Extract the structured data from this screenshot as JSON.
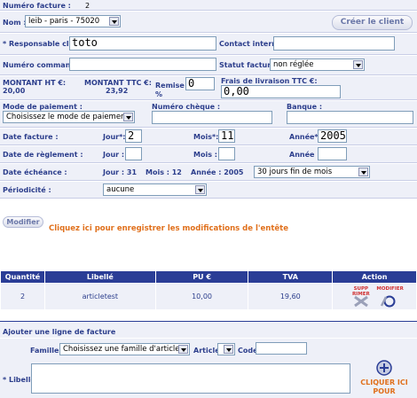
{
  "header": {
    "invoice_number_label": "Numéro facture :",
    "invoice_number_value": "2"
  },
  "client": {
    "name_label": "Nom :",
    "name_value": "leib - paris - 75020",
    "create_button": "Créer le client"
  },
  "contacts": {
    "responsable_label": "* Responsable client :",
    "responsable_value": "toto",
    "contact_interne_label": "Contact interne :",
    "contact_interne_value": ""
  },
  "order": {
    "numero_commande_label": "Numéro commande :",
    "numero_commande_value": "",
    "statut_label": "Statut facture :",
    "statut_value": "non réglée"
  },
  "amounts": {
    "ht_label": "MONTANT HT €:",
    "ht_value": "20,00",
    "ttc_label": "MONTANT TTC €:",
    "ttc_value": "23,92",
    "remise_label": "Remise :",
    "remise_unit": "%",
    "remise_value": "0",
    "frais_label": "Frais de livraison TTC €:",
    "frais_value": "0,00"
  },
  "payment": {
    "mode_label": "Mode de paiement :",
    "mode_value": "Choisissez le mode de paiement",
    "cheque_label": "Numéro chèque :",
    "cheque_value": "",
    "banque_label": "Banque :",
    "banque_value": ""
  },
  "dates": {
    "facture_label": "Date facture :",
    "reglement_label": "Date de règlement :",
    "echeance_label": "Date échéance :",
    "jour_label": "Jour*:",
    "mois_label": "Mois*:",
    "annee_label": "Année*:",
    "jour_label_plain": "Jour :",
    "mois_label_plain": "Mois :",
    "annee_label_plain": "Année :",
    "facture_jour": "2",
    "facture_mois": "11",
    "facture_annee": "2005",
    "echeance_jour": "Jour : 31",
    "echeance_mois": "Mois : 12",
    "echeance_annee": "Année : 2005",
    "echeance_terms": "30 jours fin de mois"
  },
  "periodicite": {
    "label": "Périodicité :",
    "value": "aucune"
  },
  "modify": {
    "button": "Modifier",
    "hint": "Cliquez ici pour enregistrer les modifications de l'entête"
  },
  "lines_table": {
    "headers": [
      "Quantité",
      "Libellé",
      "PU €",
      "TVA",
      "Action"
    ],
    "rows": [
      {
        "quantite": "2",
        "libelle": "articletest",
        "pu": "10,00",
        "tva": "19,60",
        "supp": "SUPP RIMER",
        "modifier": "MODIFIER"
      }
    ]
  },
  "add_line": {
    "title": "Ajouter une ligne de facture",
    "famille_label": "Famille :",
    "famille_value": "Choisissez une famille d'articles",
    "article_label": "Article",
    "code_label": "Code",
    "code_value": "",
    "libelle_label": "* Libellé:",
    "libelle_value": "",
    "add_button_line1": "CLIQUER ICI",
    "add_button_line2": "POUR"
  },
  "colors": {
    "panel": "#eef0f8",
    "table_header": "#2a3d96",
    "hint_orange": "#e0701c",
    "label_blue": "#2c3e8c"
  }
}
